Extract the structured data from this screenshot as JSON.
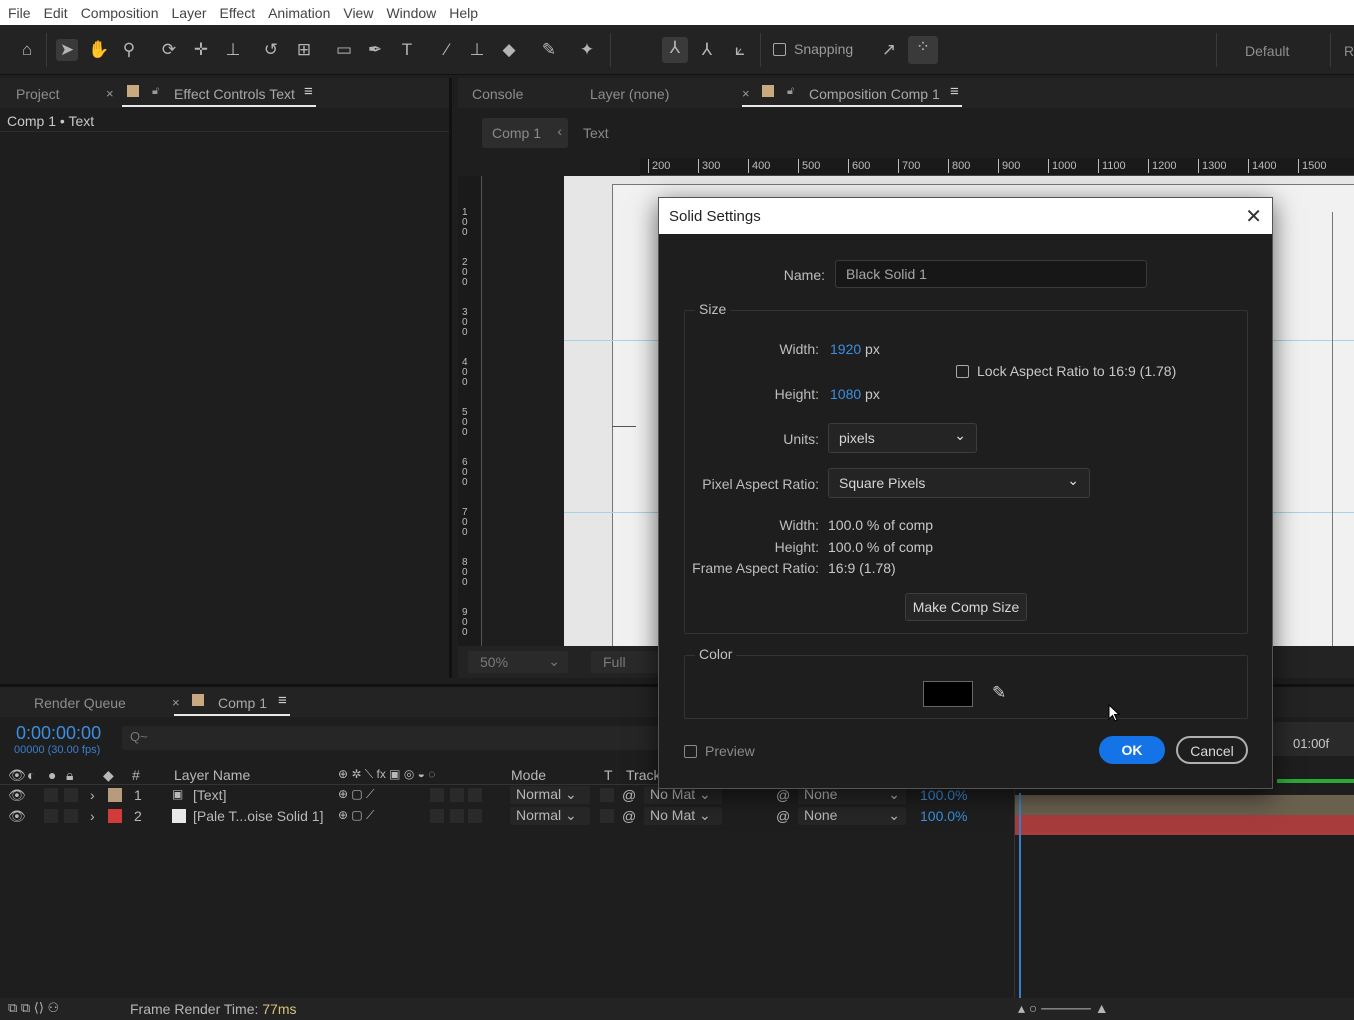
{
  "menu": [
    "File",
    "Edit",
    "Composition",
    "Layer",
    "Effect",
    "Animation",
    "View",
    "Window",
    "Help"
  ],
  "toolbar": {
    "snapping_label": "Snapping",
    "workspace": "Default",
    "workspace_cut": "R"
  },
  "left_panel": {
    "tabs": {
      "project": "Project",
      "effect_controls": "Effect Controls Text"
    },
    "subheader": "Comp 1 • Text"
  },
  "comp_panel": {
    "tabs": {
      "console": "Console",
      "layer": "Layer (none)",
      "composition": "Composition Comp 1"
    },
    "breadcrumb": {
      "comp": "Comp 1",
      "layer": "Text"
    },
    "ruler_top": [
      "200",
      "300",
      "400",
      "500",
      "600",
      "700",
      "800",
      "900",
      "1000",
      "1100",
      "1200",
      "1300",
      "1400",
      "1500"
    ],
    "ruler_left": [
      "100",
      "200",
      "300",
      "400",
      "500",
      "600",
      "700",
      "800",
      "900"
    ],
    "zoom": "50%",
    "resolution": "Full"
  },
  "timeline": {
    "tabs": {
      "render_queue": "Render Queue",
      "comp": "Comp 1"
    },
    "timecode": "0:00:00:00",
    "fps": "00000 (30.00 fps)",
    "search_placeholder": "Q~",
    "columns": {
      "num": "#",
      "layer_name": "Layer Name",
      "mode": "Mode",
      "t": "T",
      "track": "Track"
    },
    "layers": [
      {
        "num": "1",
        "name": "[Text]",
        "mode": "Normal",
        "trkmat": "No Mat",
        "parent": "None",
        "stretch": "100.0%",
        "label_color": "#b69c7c"
      },
      {
        "num": "2",
        "name": "[Pale T...oise Solid 1]",
        "mode": "Normal",
        "trkmat": "No Mat",
        "parent": "None",
        "stretch": "100.0%",
        "label_color": "#d23b3b"
      }
    ],
    "ruler_time": "01:00f"
  },
  "status": {
    "label": "Frame Render Time:",
    "value": "77ms"
  },
  "dialog": {
    "title": "Solid Settings",
    "name_label": "Name:",
    "name_value": "Black Solid 1",
    "size_group": "Size",
    "width_label": "Width:",
    "width_value": "1920",
    "height_label": "Height:",
    "height_value": "1080",
    "px": "px",
    "lock_label": "Lock Aspect Ratio to 16:9 (1.78)",
    "units_label": "Units:",
    "units_value": "pixels",
    "par_label": "Pixel Aspect Ratio:",
    "par_value": "Square Pixels",
    "pct_width_label": "Width:",
    "pct_width_value": "100.0 % of comp",
    "pct_height_label": "Height:",
    "pct_height_value": "100.0 % of comp",
    "far_label": "Frame Aspect Ratio:",
    "far_value": "16:9 (1.78)",
    "make_comp_size": "Make Comp Size",
    "color_group": "Color",
    "color_value": "#000000",
    "preview_label": "Preview",
    "ok": "OK",
    "cancel": "Cancel"
  }
}
